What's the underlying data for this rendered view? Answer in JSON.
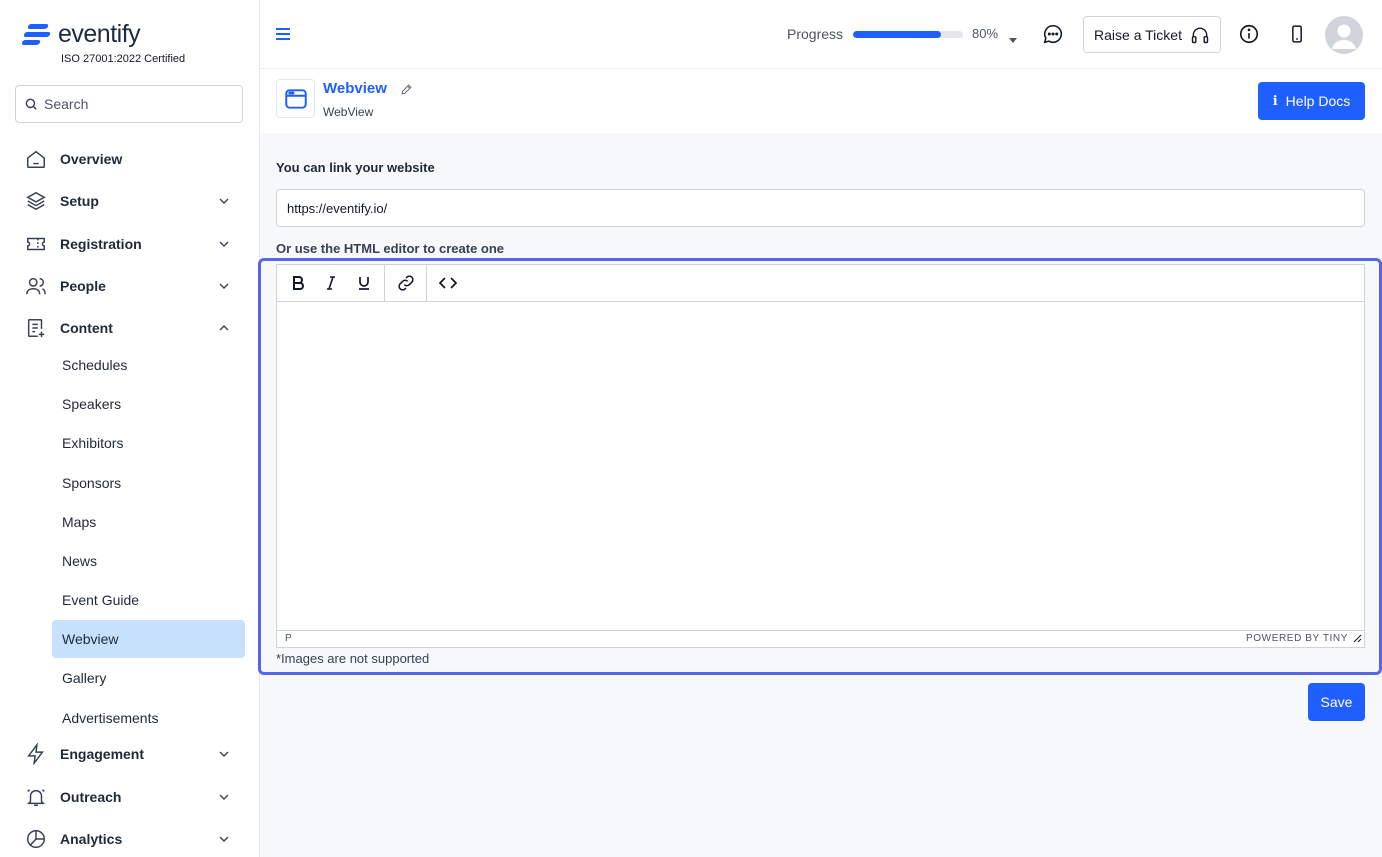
{
  "brand": {
    "name": "eventify",
    "certification": "ISO 27001:2022 Certified"
  },
  "search": {
    "placeholder": "Search"
  },
  "sidebar": {
    "items": [
      {
        "label": "Overview",
        "icon": "home-icon"
      },
      {
        "label": "Setup",
        "icon": "layers-icon"
      },
      {
        "label": "Registration",
        "icon": "ticket-icon"
      },
      {
        "label": "People",
        "icon": "users-icon"
      },
      {
        "label": "Content",
        "icon": "content-icon"
      },
      {
        "label": "Engagement",
        "icon": "bolt-icon"
      },
      {
        "label": "Outreach",
        "icon": "bell-icon"
      },
      {
        "label": "Analytics",
        "icon": "pie-chart-icon"
      }
    ],
    "content_subitems": [
      "Schedules",
      "Speakers",
      "Exhibitors",
      "Sponsors",
      "Maps",
      "News",
      "Event Guide",
      "Webview",
      "Gallery",
      "Advertisements"
    ],
    "active_subitem": "Webview"
  },
  "header": {
    "progress_label": "Progress",
    "progress_value": "80%",
    "progress_fraction": 0.8,
    "raise_ticket_label": "Raise a Ticket"
  },
  "page": {
    "title": "Webview",
    "subtitle": "WebView",
    "help_label": "Help Docs"
  },
  "form": {
    "link_label": "You can link your website",
    "url_value": "https://eventify.io/",
    "editor_label": "Or use the HTML editor to create one",
    "editor_path": "P",
    "powered_by": "POWERED BY TINY",
    "note": "*Images are not supported",
    "save_label": "Save"
  },
  "colors": {
    "accent": "#1f5eff",
    "active_bg": "#c7e0fb",
    "focus_border": "#5865e8"
  }
}
